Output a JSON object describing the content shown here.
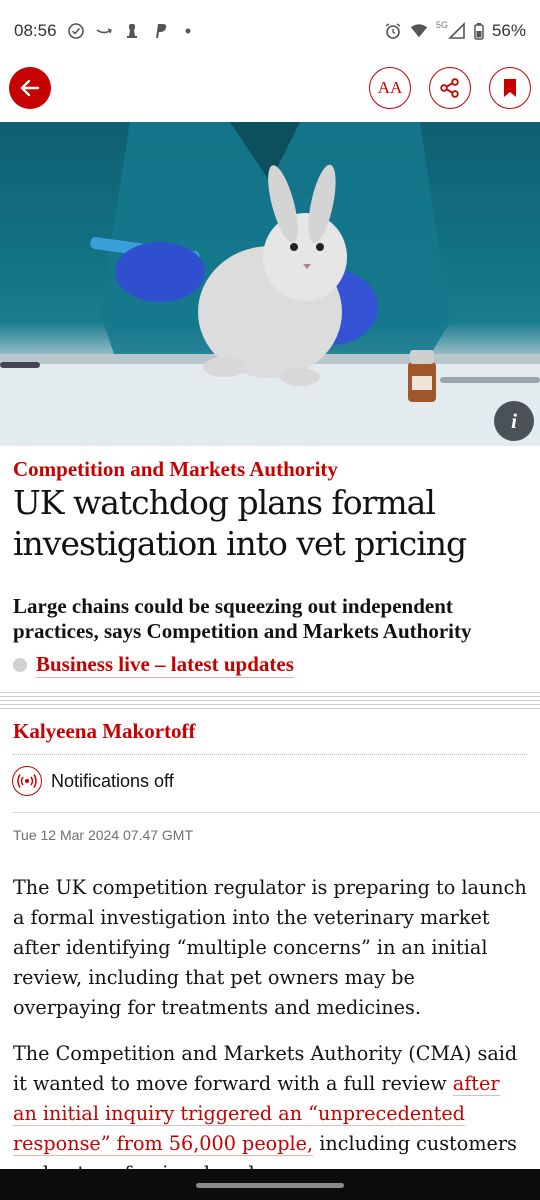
{
  "status_bar": {
    "time": "08:56",
    "network": "5G",
    "battery": "56%"
  },
  "toolbar": {
    "text_size_label": "AA",
    "icons": [
      "back-arrow-icon",
      "text-size-icon",
      "share-icon",
      "bookmark-icon"
    ]
  },
  "hero": {
    "info_label": "i"
  },
  "article": {
    "kicker": "Competition and Markets Authority",
    "headline": "UK watchdog plans formal investigation into vet pricing",
    "standfirst": "Large chains could be squeezing out independent practices, says Competition and Markets Authority",
    "live_link": "Business live – latest updates",
    "byline": "Kalyeena Makortoff",
    "notifications_label": "Notifications off",
    "dateline": "Tue 12 Mar 2024 07.47 GMT",
    "paragraph1": "The UK competition regulator is preparing to launch a formal investigation into the veterinary market after identifying “multiple concerns” in an initial review, including that pet owners may be overpaying for treatments and medicines.",
    "paragraph2_start": "The Competition and Markets Authority (CMA) said it wanted to move forward with a full review ",
    "paragraph2_link": "after an initial inquiry triggered an “unprecedented response” from 56,000 people,",
    "paragraph2_end": " including customers and vet professionals, who"
  },
  "colors": {
    "accent": "#c70000",
    "text": "#121212",
    "muted": "#707070"
  }
}
